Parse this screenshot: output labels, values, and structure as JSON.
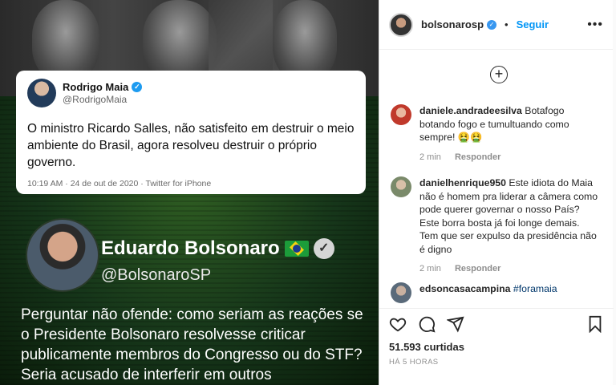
{
  "tweet": {
    "name": "Rodrigo Maia",
    "handle": "@RodrigoMaia",
    "text": "O ministro Ricardo Salles, não satisfeito em destruir o meio ambiente do Brasil, agora resolveu destruir o próprio governo.",
    "meta": "10:19 AM · 24 de out de 2020 · Twitter for iPhone"
  },
  "second_tweet": {
    "name": "Eduardo Bolsonaro",
    "handle": "@BolsonaroSP",
    "text": "Perguntar não ofende: como seriam as reações se o Presidente Bolsonaro resolvesse criticar publicamente membros do Congresso ou do STF? Seria acusado de interferir em outros"
  },
  "header": {
    "username": "bolsonarosp",
    "separator": "•",
    "follow_label": "Seguir",
    "more": "•••"
  },
  "comments": [
    {
      "user": "daniele.andradeesilva",
      "text": "Botafogo botando fogo e tumultuando como sempre! 🤮🤮",
      "time": "2 min",
      "reply": "Responder",
      "avatar_color": "#c0392b"
    },
    {
      "user": "danielhenrique950",
      "text": "Este idiota do Maia não é homem pra liderar a câmera como pode querer governar o nosso País? Este borra bosta já foi longe demais. Tem que ser expulso da presidência não é digno",
      "time": "2 min",
      "reply": "Responder",
      "avatar_color": "#7a8a6a"
    },
    {
      "user": "edsoncasacampina",
      "tag": "#foramaia",
      "avatar_color": "#5a6a7a"
    }
  ],
  "footer": {
    "likes": "51.593 curtidas",
    "posted": "HÁ 5 HORAS"
  }
}
